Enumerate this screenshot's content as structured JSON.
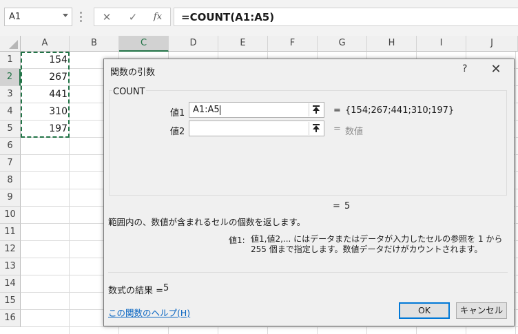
{
  "formula_bar": {
    "name_box": "A1",
    "cancel_icon": "✕",
    "enter_icon": "✓",
    "fx_icon": "fx",
    "formula": "=COUNT(A1:A5)"
  },
  "sheet": {
    "columns": [
      "A",
      "B",
      "C",
      "D",
      "E",
      "F",
      "G",
      "H",
      "I",
      "J"
    ],
    "rows": [
      "1",
      "2",
      "3",
      "4",
      "5",
      "6",
      "7",
      "8",
      "9",
      "10",
      "11",
      "12",
      "13",
      "14",
      "15",
      "16"
    ],
    "column_a_values": [
      "154",
      "267",
      "441",
      "310",
      "197"
    ]
  },
  "dialog": {
    "title": "関数の引数",
    "help_glyph": "?",
    "close_glyph": "✕",
    "function_name": "COUNT",
    "args": [
      {
        "label": "値1",
        "value": "A1:A5",
        "eq": "=",
        "result": "{154;267;441;310;197}"
      },
      {
        "label": "値2",
        "value": "",
        "eq": "=",
        "result": "数値"
      }
    ],
    "total_eq": "=",
    "total": "5",
    "description": "範囲内の、数値が含まれるセルの個数を返します。",
    "arg_help_name": "値1:",
    "arg_help_text": "値1,値2,... にはデータまたはデータが入力したセルの参照を 1 から 255 個まで指定します。数値データだけがカウントされます。",
    "formula_result_label": "数式の結果 =",
    "formula_result_value": "5",
    "help_link": "この関数のヘルプ(H)",
    "ok_label": "OK",
    "cancel_label": "キャンセル"
  }
}
